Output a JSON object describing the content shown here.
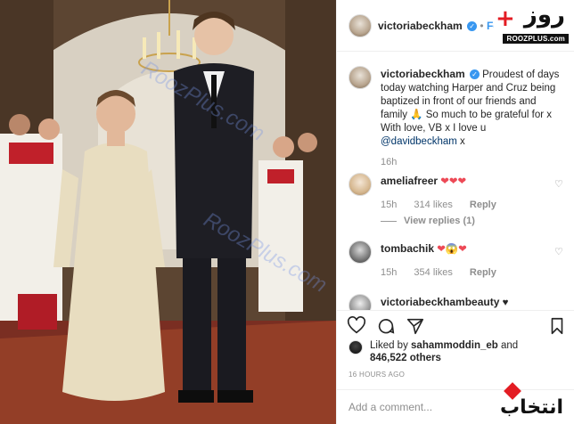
{
  "post": {
    "username": "victoriabeckham",
    "follow_label": "Follo",
    "caption_user": "victoriabeckham",
    "caption_text": "Proudest of days today watching Harper and Cruz being baptized in front of our friends and family 🙏 So much to be grateful for x With love, VB x I love u",
    "caption_mention": "@davidbeckham",
    "caption_end": " x",
    "caption_age": "16h"
  },
  "comments": [
    {
      "user": "ameliafreer",
      "text": "❤❤❤",
      "age": "15h",
      "likes": "314 likes",
      "reply": "Reply",
      "view_replies": "View replies (1)"
    },
    {
      "user": "tombachik",
      "text": "❤😱❤",
      "age": "15h",
      "likes": "354 likes",
      "reply": "Reply"
    },
    {
      "user": "victoriabeckhambeauty",
      "text": "♥"
    }
  ],
  "actions": {
    "liked_by_prefix": "Liked by ",
    "liked_by_user": "sahammoddin_eb",
    "liked_by_and": " and",
    "others_count": "846,522 others",
    "timestamp": "16 HOURS AGO",
    "add_comment_placeholder": "Add a comment..."
  },
  "watermarks": {
    "site_logo": "روز",
    "site_plus": "+",
    "site_url": "ROOZPLUS.com",
    "source_logo": "انتخاب",
    "photo_wm": "RoozPlus.com"
  },
  "colors": {
    "link": "#3897f0",
    "heart": "#ed4956",
    "verified": "#3897f0"
  }
}
